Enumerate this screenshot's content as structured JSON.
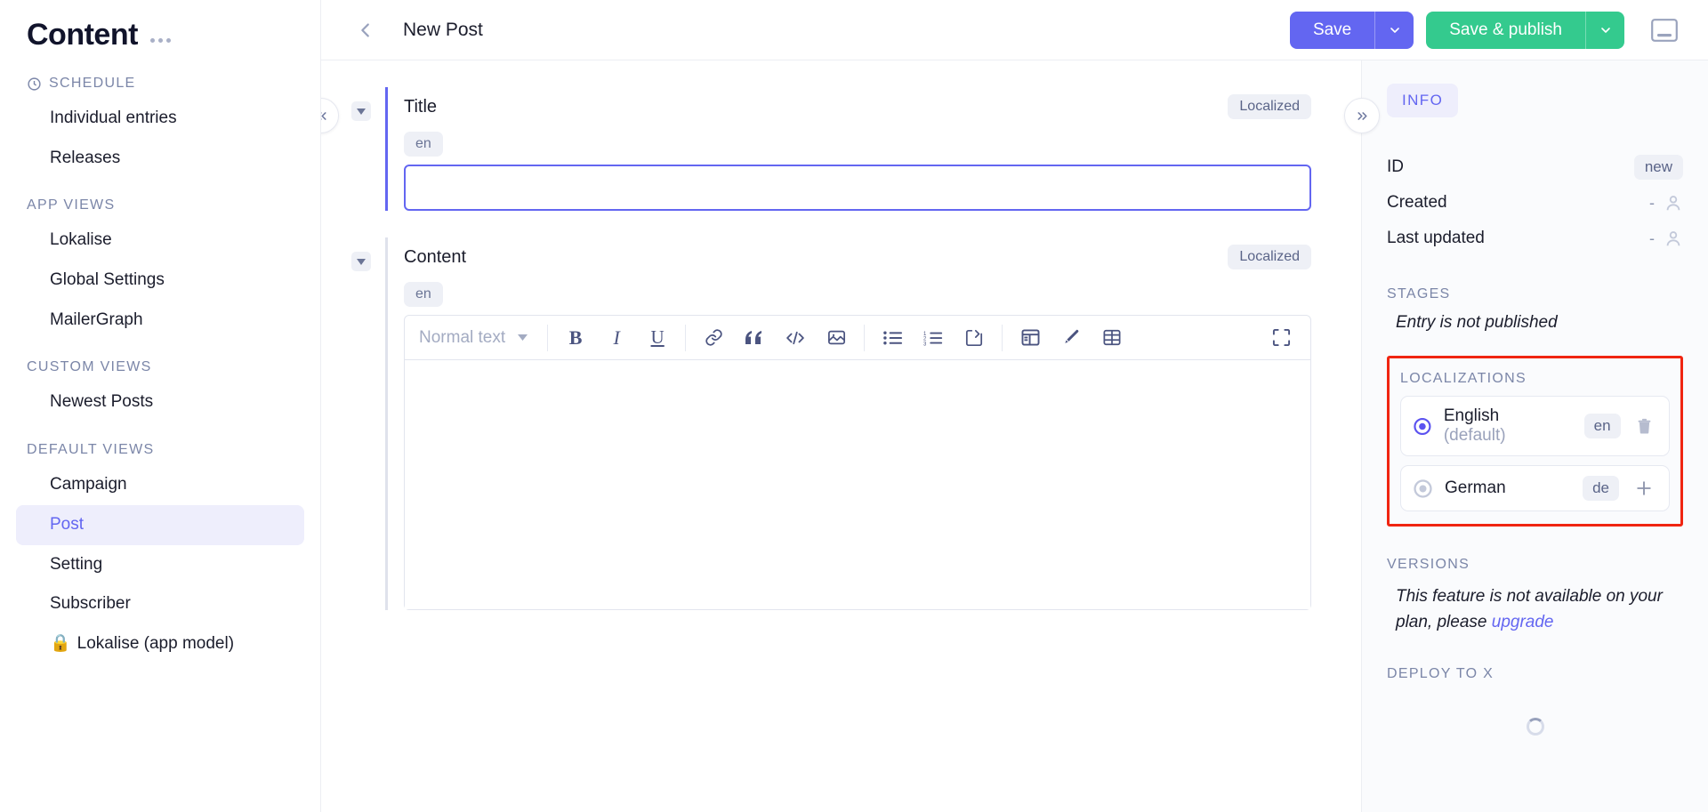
{
  "sidebar": {
    "title": "Content",
    "menu_icon": "more-horizontal-icon",
    "sections": [
      {
        "label": "SCHEDULE",
        "icon": "clock-icon",
        "items": [
          {
            "label": "Individual entries",
            "active": false
          },
          {
            "label": "Releases",
            "active": false
          }
        ]
      },
      {
        "label": "APP VIEWS",
        "icon": null,
        "items": [
          {
            "label": "Lokalise",
            "active": false
          },
          {
            "label": "Global Settings",
            "active": false
          },
          {
            "label": "MailerGraph",
            "active": false
          }
        ]
      },
      {
        "label": "CUSTOM VIEWS",
        "icon": null,
        "items": [
          {
            "label": "Newest Posts",
            "active": false
          }
        ]
      },
      {
        "label": "DEFAULT VIEWS",
        "icon": null,
        "items": [
          {
            "label": "Campaign",
            "active": false
          },
          {
            "label": "Post",
            "active": true
          },
          {
            "label": "Setting",
            "active": false
          },
          {
            "label": "Subscriber",
            "active": false
          },
          {
            "label": "Lokalise (app model)",
            "active": false,
            "lock": "🔒"
          }
        ]
      }
    ]
  },
  "topbar": {
    "back_icon": "chevron-left-icon",
    "title": "New Post",
    "save_label": "Save",
    "save_caret_icon": "chevron-down-icon",
    "publish_label": "Save & publish",
    "publish_caret_icon": "chevron-down-icon",
    "window_icon": "minimize-window-icon"
  },
  "editor": {
    "collapse_left_icon": "chevrons-left-icon",
    "fields": [
      {
        "name": "Title",
        "localized_badge": "Localized",
        "lang_chip": "en",
        "value": "",
        "placeholder": ""
      },
      {
        "name": "Content",
        "localized_badge": "Localized",
        "lang_chip": "en",
        "value": "",
        "placeholder": ""
      }
    ],
    "toolbar": {
      "block_style": "Normal text",
      "block_caret_icon": "caret-down-icon",
      "buttons": [
        {
          "name": "bold-icon",
          "glyph": "B"
        },
        {
          "name": "italic-icon",
          "glyph": "I"
        },
        {
          "name": "underline-icon",
          "glyph": "U"
        },
        {
          "name": "link-icon",
          "glyph": "link"
        },
        {
          "name": "quote-icon",
          "glyph": "quote"
        },
        {
          "name": "code-icon",
          "glyph": "</>"
        },
        {
          "name": "image-icon",
          "glyph": "image"
        },
        {
          "name": "bullet-list-icon",
          "glyph": "bullets"
        },
        {
          "name": "numbered-list-icon",
          "glyph": "numbered"
        },
        {
          "name": "embed-icon",
          "glyph": "embed"
        },
        {
          "name": "layout-icon",
          "glyph": "layout"
        },
        {
          "name": "brush-icon",
          "glyph": "brush"
        },
        {
          "name": "table-icon",
          "glyph": "table"
        },
        {
          "name": "fullscreen-icon",
          "glyph": "fullscreen"
        }
      ]
    }
  },
  "info_panel": {
    "collapse_right_icon": "chevrons-right-icon",
    "tab_label": "INFO",
    "meta": [
      {
        "label": "ID",
        "value": "new",
        "type": "badge"
      },
      {
        "label": "Created",
        "value": "-",
        "type": "dash-user"
      },
      {
        "label": "Last updated",
        "value": "-",
        "type": "dash-user"
      }
    ],
    "stages_heading": "STAGES",
    "stages_text": "Entry is not published",
    "localizations_heading": "LOCALIZATIONS",
    "localizations": [
      {
        "name": "English",
        "suffix": "(default)",
        "code": "en",
        "action": "delete-icon",
        "selected": true
      },
      {
        "name": "German",
        "suffix": "",
        "code": "de",
        "action": "add-icon",
        "selected": false
      }
    ],
    "versions_heading": "VERSIONS",
    "versions_text": "This feature is not available on your plan, please ",
    "versions_link": "upgrade",
    "deploy_heading": "DEPLOY TO X",
    "deploy_spinner": "loading-spinner"
  },
  "colors": {
    "accent_purple": "#6366f1",
    "accent_green": "#34ca8e",
    "highlight_red": "#f02511",
    "muted": "#7b86a8"
  }
}
